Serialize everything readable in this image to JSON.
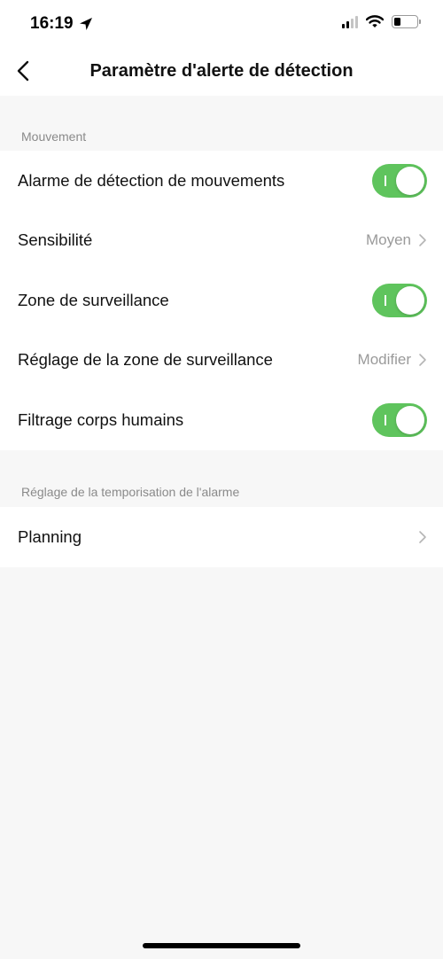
{
  "status_bar": {
    "time": "16:19",
    "icons": [
      "location-arrow-icon",
      "cellular-signal-icon",
      "wifi-icon",
      "battery-icon"
    ]
  },
  "nav": {
    "title": "Paramètre d'alerte de détection",
    "back_icon": "chevron-left-icon"
  },
  "sections": [
    {
      "header": "Mouvement",
      "rows": [
        {
          "label": "Alarme de détection de mouvements",
          "type": "toggle",
          "on": true,
          "toggle_mark": "I"
        },
        {
          "label": "Sensibilité",
          "type": "value",
          "value": "Moyen"
        },
        {
          "label": "Zone de surveillance",
          "type": "toggle",
          "on": true,
          "toggle_mark": "I"
        },
        {
          "label": "Réglage de la zone de surveillance",
          "type": "value",
          "value": "Modifier"
        },
        {
          "label": "Filtrage corps humains",
          "type": "toggle",
          "on": true,
          "toggle_mark": "I"
        }
      ]
    },
    {
      "header": "Réglage de la temporisation de l'alarme",
      "rows": [
        {
          "label": "Planning",
          "type": "chevron"
        }
      ]
    }
  ],
  "colors": {
    "toggle_on": "#5fc45d",
    "background": "#f7f7f7",
    "secondary_text": "#9a9a9a"
  }
}
